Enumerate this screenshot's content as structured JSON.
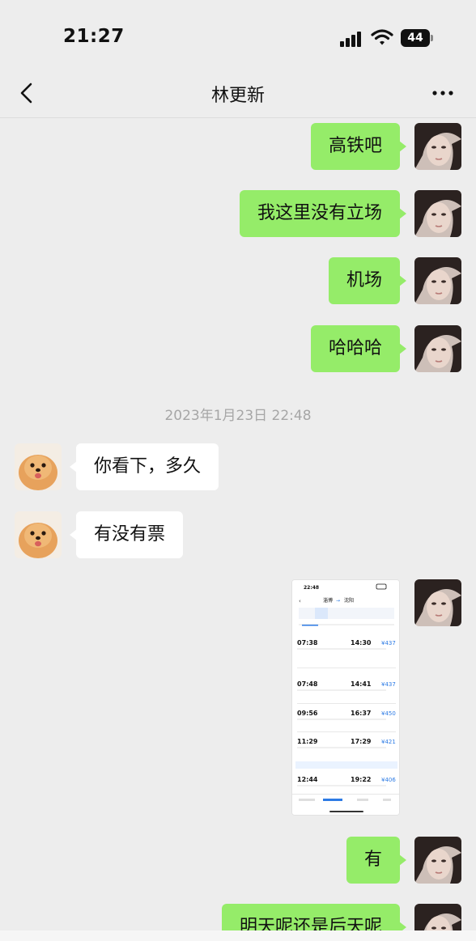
{
  "status_bar": {
    "time": "21:27",
    "battery": "44"
  },
  "nav": {
    "title": "林更新"
  },
  "messages": [
    {
      "side": "me",
      "text": "高铁吧"
    },
    {
      "side": "me",
      "text": "我这里没有立场"
    },
    {
      "side": "me",
      "text": "机场"
    },
    {
      "side": "me",
      "text": "哈哈哈"
    },
    {
      "side": "other",
      "text": "你看下，多久"
    },
    {
      "side": "other",
      "text": "有没有票"
    },
    {
      "side": "me",
      "text": "有"
    },
    {
      "side": "me",
      "text": "明天呢还是后天呢"
    }
  ],
  "timestamp": "2023年1月23日 22:48",
  "screenshot_message": {
    "status_time": "22:48",
    "route_from": "淄博",
    "route_to": "沈阳",
    "trains": [
      {
        "dep": "07:38",
        "arr": "14:30",
        "price": "¥437"
      },
      {
        "dep": "07:48",
        "arr": "14:41",
        "price": "¥437"
      },
      {
        "dep": "09:56",
        "arr": "16:37",
        "price": "¥450"
      },
      {
        "dep": "11:29",
        "arr": "17:29",
        "price": "¥421"
      },
      {
        "dep": "12:44",
        "arr": "19:22",
        "price": "¥406"
      }
    ]
  },
  "colors": {
    "chat_bg": "#ededed",
    "my_bubble": "#95ec69",
    "their_bubble": "#ffffff"
  }
}
